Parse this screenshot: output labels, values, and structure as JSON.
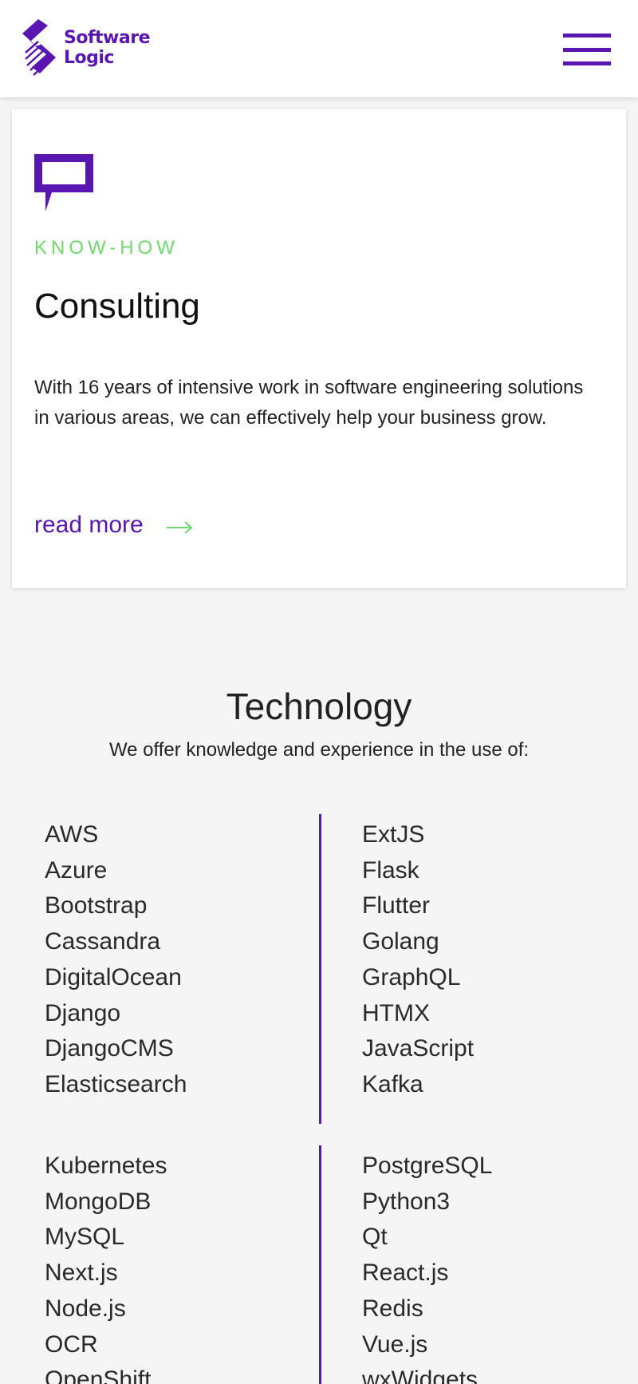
{
  "brand": {
    "logo_line1": "Software",
    "logo_line2": "Logic",
    "primary_color": "#5a16b0",
    "accent_color": "#6fd96a"
  },
  "header": {
    "menu_icon": "hamburger-menu-icon"
  },
  "card": {
    "icon": "speech-bubble-icon",
    "kicker": "KNOW-HOW",
    "title": "Consulting",
    "body": "With 16 years of intensive work in software engineering solutions in various areas, we can effectively help your business grow.",
    "link_label": "read more",
    "link_icon": "arrow-right-icon"
  },
  "technology": {
    "title": "Technology",
    "subtitle": "We offer knowledge and experience in the use of:",
    "groups": [
      {
        "left": [
          "AWS",
          "Azure",
          "Bootstrap",
          "Cassandra",
          "DigitalOcean",
          "Django",
          "DjangoCMS",
          "Elasticsearch"
        ],
        "right": [
          "ExtJS",
          "Flask",
          "Flutter",
          "Golang",
          "GraphQL",
          "HTMX",
          "JavaScript",
          "Kafka"
        ]
      },
      {
        "left": [
          "Kubernetes",
          "MongoDB",
          "MySQL",
          "Next.js",
          "Node.js",
          "OCR",
          "OpenShift"
        ],
        "right": [
          "PostgreSQL",
          "Python3",
          "Qt",
          "React.js",
          "Redis",
          "Vue.js",
          "wxWidgets"
        ]
      }
    ]
  }
}
